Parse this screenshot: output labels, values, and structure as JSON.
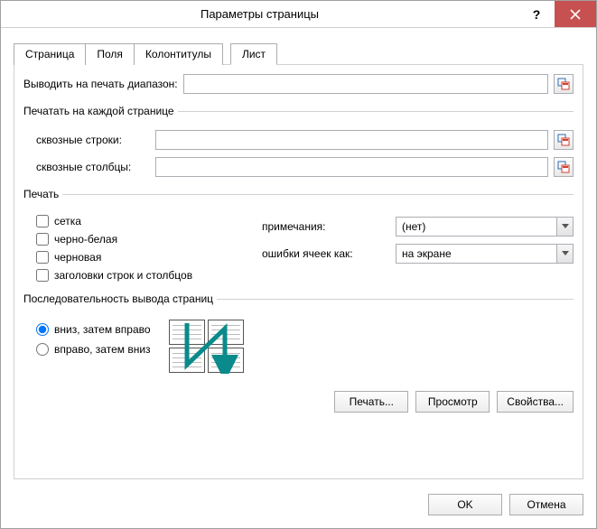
{
  "title": "Параметры страницы",
  "tabs": {
    "page": "Страница",
    "fields": "Поля",
    "headers": "Колонтитулы",
    "sheet": "Лист"
  },
  "print_range_label": "Выводить на печать диапазон:",
  "print_range_value": "",
  "repeat_group_label": "Печатать на каждой странице",
  "rows_label": "сквозные строки:",
  "rows_value": "",
  "cols_label": "сквозные столбцы:",
  "cols_value": "",
  "print_group_label": "Печать",
  "checkboxes": {
    "grid": "сетка",
    "bw": "черно-белая",
    "draft": "черновая",
    "headings": "заголовки строк и столбцов"
  },
  "notes_label": "примечания:",
  "notes_value": "(нет)",
  "errors_label": "ошибки ячеек как:",
  "errors_value": "на экране",
  "order_group_label": "Последовательность вывода страниц",
  "order_down": "вниз, затем вправо",
  "order_right": "вправо, затем вниз",
  "buttons": {
    "print": "Печать...",
    "preview": "Просмотр",
    "props": "Свойства...",
    "ok": "OK",
    "cancel": "Отмена"
  }
}
